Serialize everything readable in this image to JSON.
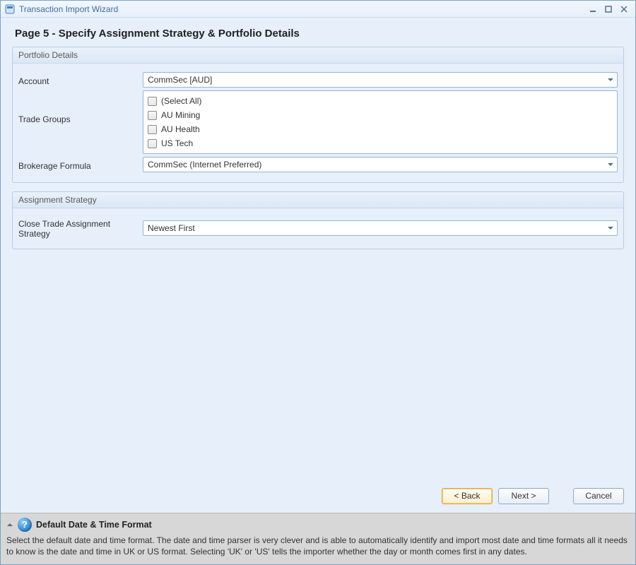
{
  "window": {
    "title": "Transaction Import Wizard"
  },
  "page": {
    "heading": "Page 5 - Specify Assignment Strategy & Portfolio Details"
  },
  "portfolio": {
    "title": "Portfolio Details",
    "account_label": "Account",
    "account_value": "CommSec [AUD]",
    "trade_groups_label": "Trade Groups",
    "trade_groups": [
      {
        "label": "(Select All)",
        "checked": false
      },
      {
        "label": "AU Mining",
        "checked": false
      },
      {
        "label": "AU Health",
        "checked": false
      },
      {
        "label": "US Tech",
        "checked": false
      }
    ],
    "brokerage_label": "Brokerage Formula",
    "brokerage_value": "CommSec (Internet Preferred)"
  },
  "assignment": {
    "title": "Assignment Strategy",
    "close_label": "Close Trade Assignment Strategy",
    "close_value": "Newest First"
  },
  "buttons": {
    "back": "< Back",
    "next": "Next >",
    "cancel": "Cancel"
  },
  "help": {
    "title": "Default Date & Time Format",
    "body": "Select the default date and time format. The date and time parser is very clever and is able to automatically identify and import most date and time formats all it needs to know is the date and time in UK or US format. Selecting 'UK' or 'US' tells the importer whether the day or month comes first in any dates."
  }
}
